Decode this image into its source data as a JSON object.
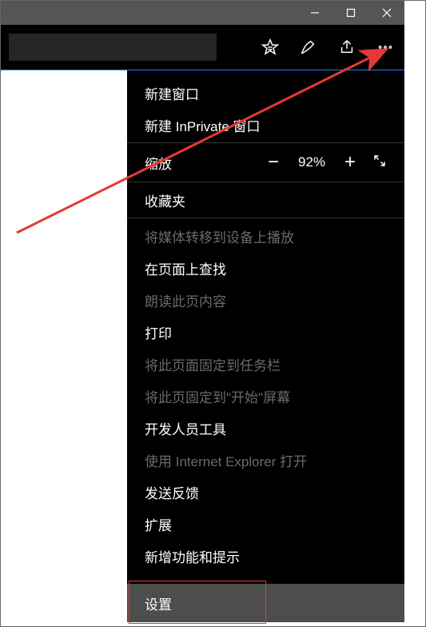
{
  "menu": {
    "new_window": "新建窗口",
    "new_inprivate": "新建 InPrivate 窗口",
    "zoom_label": "缩放",
    "zoom_minus": "−",
    "zoom_value": "92%",
    "zoom_plus": "+",
    "favorites": "收藏夹",
    "cast": "将媒体转移到设备上播放",
    "find": "在页面上查找",
    "read_aloud": "朗读此页内容",
    "print": "打印",
    "pin_taskbar": "将此页面固定到任务栏",
    "pin_start": "将此页固定到\"开始\"屏幕",
    "devtools": "开发人员工具",
    "open_ie": "使用 Internet Explorer 打开",
    "feedback": "发送反馈",
    "extensions": "扩展",
    "whats_new": "新增功能和提示",
    "settings": "设置"
  }
}
